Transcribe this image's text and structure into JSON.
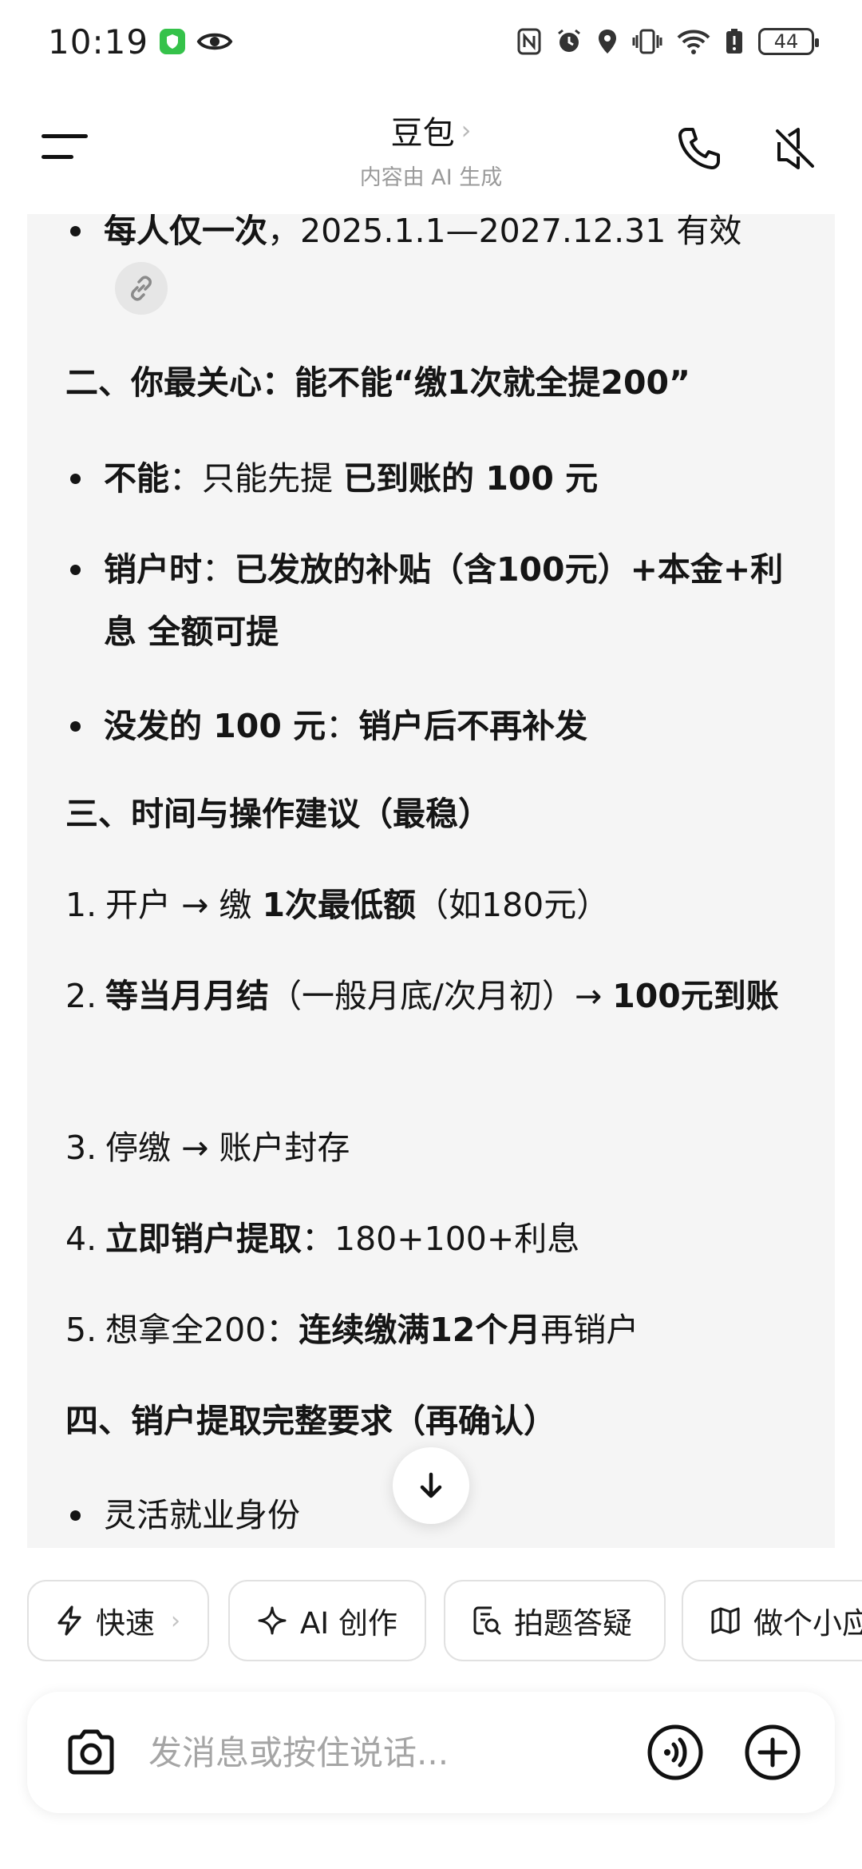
{
  "status_bar": {
    "time": "10:19",
    "battery": "44",
    "icons": [
      "shield-badge-icon",
      "eye-icon",
      "nfc-icon",
      "alarm-icon",
      "location-icon",
      "vibrate-icon",
      "wifi-icon",
      "battery-alert-icon"
    ]
  },
  "header": {
    "title": "豆包",
    "title_chevron": "›",
    "subtitle": "内容由 AI 生成"
  },
  "content": {
    "line_top": {
      "bold": "每人仅一次",
      "text": "，2025.1.1—2027.12.31 有效"
    },
    "heading2": "二、你最关心：能不能“缴1次就全提200”",
    "b1": {
      "bold": "不能",
      "text": "：只能先提 ",
      "bold2": "已到账的 100 元"
    },
    "b2": {
      "bold": "销户时",
      "text": "：",
      "bold2": "已发放的补贴（含100元）+本金+利息 全额可提"
    },
    "b3": {
      "bold": "没发的 100 元",
      "text": "：",
      "bold2": "销户后不再补发"
    },
    "heading3": "三、时间与操作建议（最稳）",
    "n1": {
      "num": "1.",
      "t1": "开户 → 缴 ",
      "bold": "1次最低额",
      "t2": "（如180元）"
    },
    "n2": {
      "num": "2.",
      "bold": "等当月月结",
      "t1": "（一般月底/次月初）→ ",
      "bold2": "100元到账"
    },
    "n3": {
      "num": "3.",
      "t1": "停缴 → 账户封存"
    },
    "n4": {
      "num": "4.",
      "bold": "立即销户提取",
      "t1": "：180+100+利息"
    },
    "n5": {
      "num": "5.",
      "t1": "想拿全200：",
      "bold": "连续缴满12个月",
      "t2": "再销户"
    },
    "heading4": "四、销户提取完整要求（再确认）",
    "b4": "灵活就业身份"
  },
  "chips": [
    {
      "label": "快速",
      "icon": "lightning-icon",
      "chevron": "›"
    },
    {
      "label": "AI 创作",
      "icon": "sparkle-icon"
    },
    {
      "label": "拍题答疑",
      "icon": "photo-question-icon"
    },
    {
      "label": "做个小应",
      "icon": "map-icon"
    }
  ],
  "input": {
    "placeholder": "发消息或按住说话..."
  },
  "colors": {
    "content_bg": "#f5f5f5",
    "text": "#151515",
    "muted": "#9a9a9a",
    "shield_green": "#35c24a"
  }
}
